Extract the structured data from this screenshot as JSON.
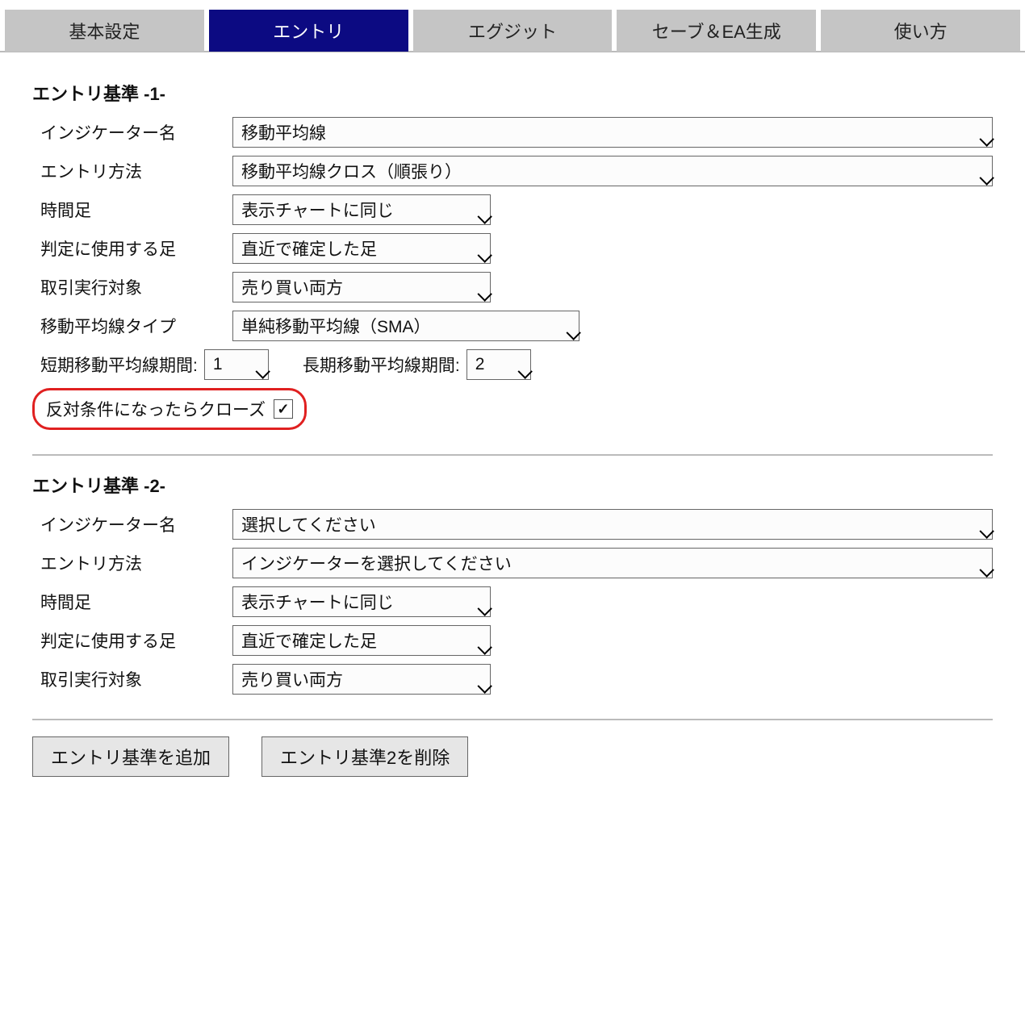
{
  "tabs": {
    "basic": "基本設定",
    "entry": "エントリ",
    "exit": "エグジット",
    "save": "セーブ＆EA生成",
    "howto": "使い方"
  },
  "section1": {
    "title": "エントリ基準 -1-",
    "indicator_label": "インジケーター名",
    "indicator_value": "移動平均線",
    "method_label": "エントリ方法",
    "method_value": "移動平均線クロス（順張り）",
    "timeframe_label": "時間足",
    "timeframe_value": "表示チャートに同じ",
    "bar_label": "判定に使用する足",
    "bar_value": "直近で確定した足",
    "target_label": "取引実行対象",
    "target_value": "売り買い両方",
    "matype_label": "移動平均線タイプ",
    "matype_value": "単純移動平均線（SMA）",
    "short_period_label": "短期移動平均線期間:",
    "short_period_value": "1",
    "long_period_label": "長期移動平均線期間:",
    "long_period_value": "2",
    "close_on_opposite_label": "反対条件になったらクローズ",
    "close_on_opposite_checked": "✓"
  },
  "section2": {
    "title": "エントリ基準 -2-",
    "indicator_label": "インジケーター名",
    "indicator_value": "選択してください",
    "method_label": "エントリ方法",
    "method_value": "インジケーターを選択してください",
    "timeframe_label": "時間足",
    "timeframe_value": "表示チャートに同じ",
    "bar_label": "判定に使用する足",
    "bar_value": "直近で確定した足",
    "target_label": "取引実行対象",
    "target_value": "売り買い両方"
  },
  "buttons": {
    "add": "エントリ基準を追加",
    "delete": "エントリ基準2を削除"
  }
}
